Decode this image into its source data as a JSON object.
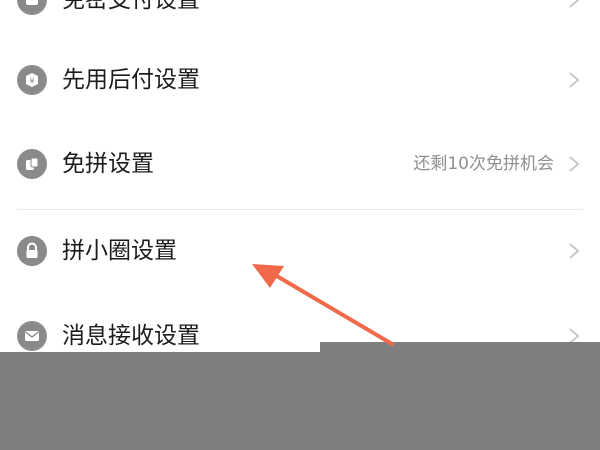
{
  "settings": {
    "items": [
      {
        "label": "免密支付设置",
        "detail": "",
        "icon": "payment-icon"
      },
      {
        "label": "先用后付设置",
        "detail": "",
        "icon": "pay-later-icon"
      },
      {
        "label": "免拼设置",
        "detail": "还剩10次免拼机会",
        "icon": "free-group-icon"
      },
      {
        "label": "拼小圈设置",
        "detail": "",
        "icon": "lock-icon"
      },
      {
        "label": "消息接收设置",
        "detail": "",
        "icon": "message-icon"
      }
    ]
  },
  "colors": {
    "icon": "#8a8a8a",
    "arrow": "#f06a4a",
    "overlay": "#7f7f7f",
    "chevron": "#c8c8c8"
  }
}
